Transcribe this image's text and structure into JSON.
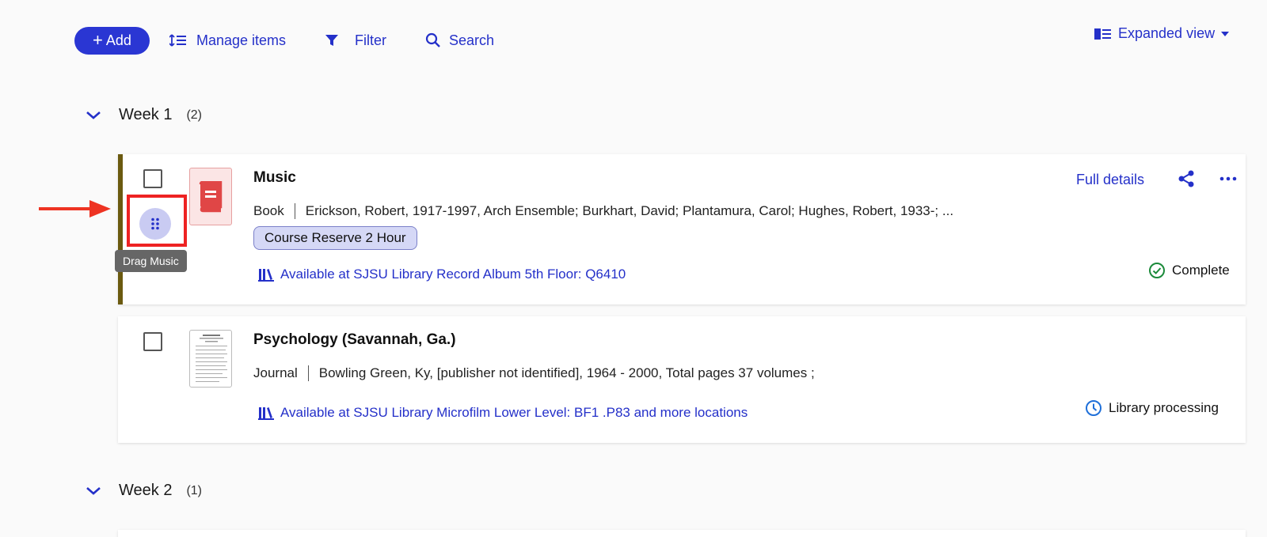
{
  "toolbar": {
    "add_label": "Add",
    "manage_label": "Manage items",
    "filter_label": "Filter",
    "search_label": "Search",
    "view_label": "Expanded view"
  },
  "sections": [
    {
      "title": "Week 1",
      "count": "(2)",
      "items": [
        {
          "title": "Music",
          "type": "Book",
          "details": "Erickson, Robert, 1917-1997, Arch Ensemble; Burkhart, David; Plantamura, Carol; Hughes, Robert, 1933-; ...",
          "tag": "Course Reserve 2 Hour",
          "availability": "Available at SJSU Library Record Album 5th Floor: Q6410",
          "status": "Complete",
          "full_details_label": "Full details",
          "drag_tooltip": "Drag Music"
        },
        {
          "title": "Psychology (Savannah, Ga.)",
          "type": "Journal",
          "details": "Bowling Green, Ky, [publisher not identified], 1964 - 2000, Total pages 37 volumes ;",
          "availability": "Available at SJSU Library Microfilm Lower Level: BF1 .P83 and more locations",
          "status": "Library processing"
        }
      ]
    },
    {
      "title": "Week 2",
      "count": "(1)"
    }
  ],
  "colors": {
    "accent": "#2430c9",
    "add_button": "#2a36d3",
    "card_border": "#6b5a10",
    "highlight": "#ee2222",
    "complete": "#1b8a3a",
    "processing": "#1e6fd9"
  }
}
